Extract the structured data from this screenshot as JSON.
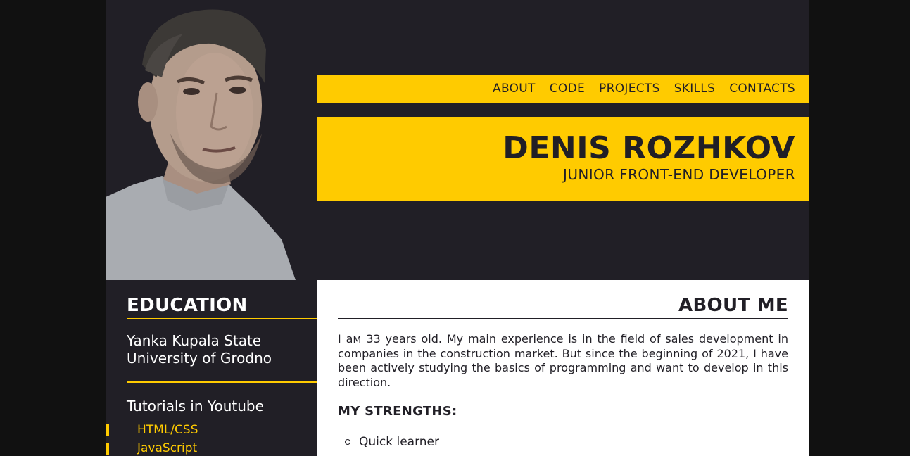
{
  "nav": {
    "items": [
      {
        "label": "ABOUT"
      },
      {
        "label": "CODE"
      },
      {
        "label": "PROJECTS"
      },
      {
        "label": "SKILLS"
      },
      {
        "label": "CONTACTS"
      }
    ]
  },
  "header": {
    "name": "DENIS ROZHKOV",
    "role": "JUNIOR FRONT-END DEVELOPER"
  },
  "sidebar": {
    "education_title": "EDUCATION",
    "university": "Yanka Kupala State University of Grodno",
    "tutorials_title": "Tutorials in Youtube",
    "tutorials": [
      {
        "label": "HTML/CSS"
      },
      {
        "label": "JavaScript"
      }
    ]
  },
  "about": {
    "title": "ABOUT ME",
    "text": "I aм 33 years old. My main experience is in the field of sales development in companies in the construction market. But since the beginning of 2021, I have been actively studying the basics of programming and want to develop in this direction.",
    "strengths_title": "MY STRENGTHS:",
    "strengths": [
      "Quick learner"
    ]
  },
  "colors": {
    "accent": "#ffcb00",
    "dark": "#211f26",
    "outer": "#111111",
    "content_bg": "#ffffff"
  }
}
